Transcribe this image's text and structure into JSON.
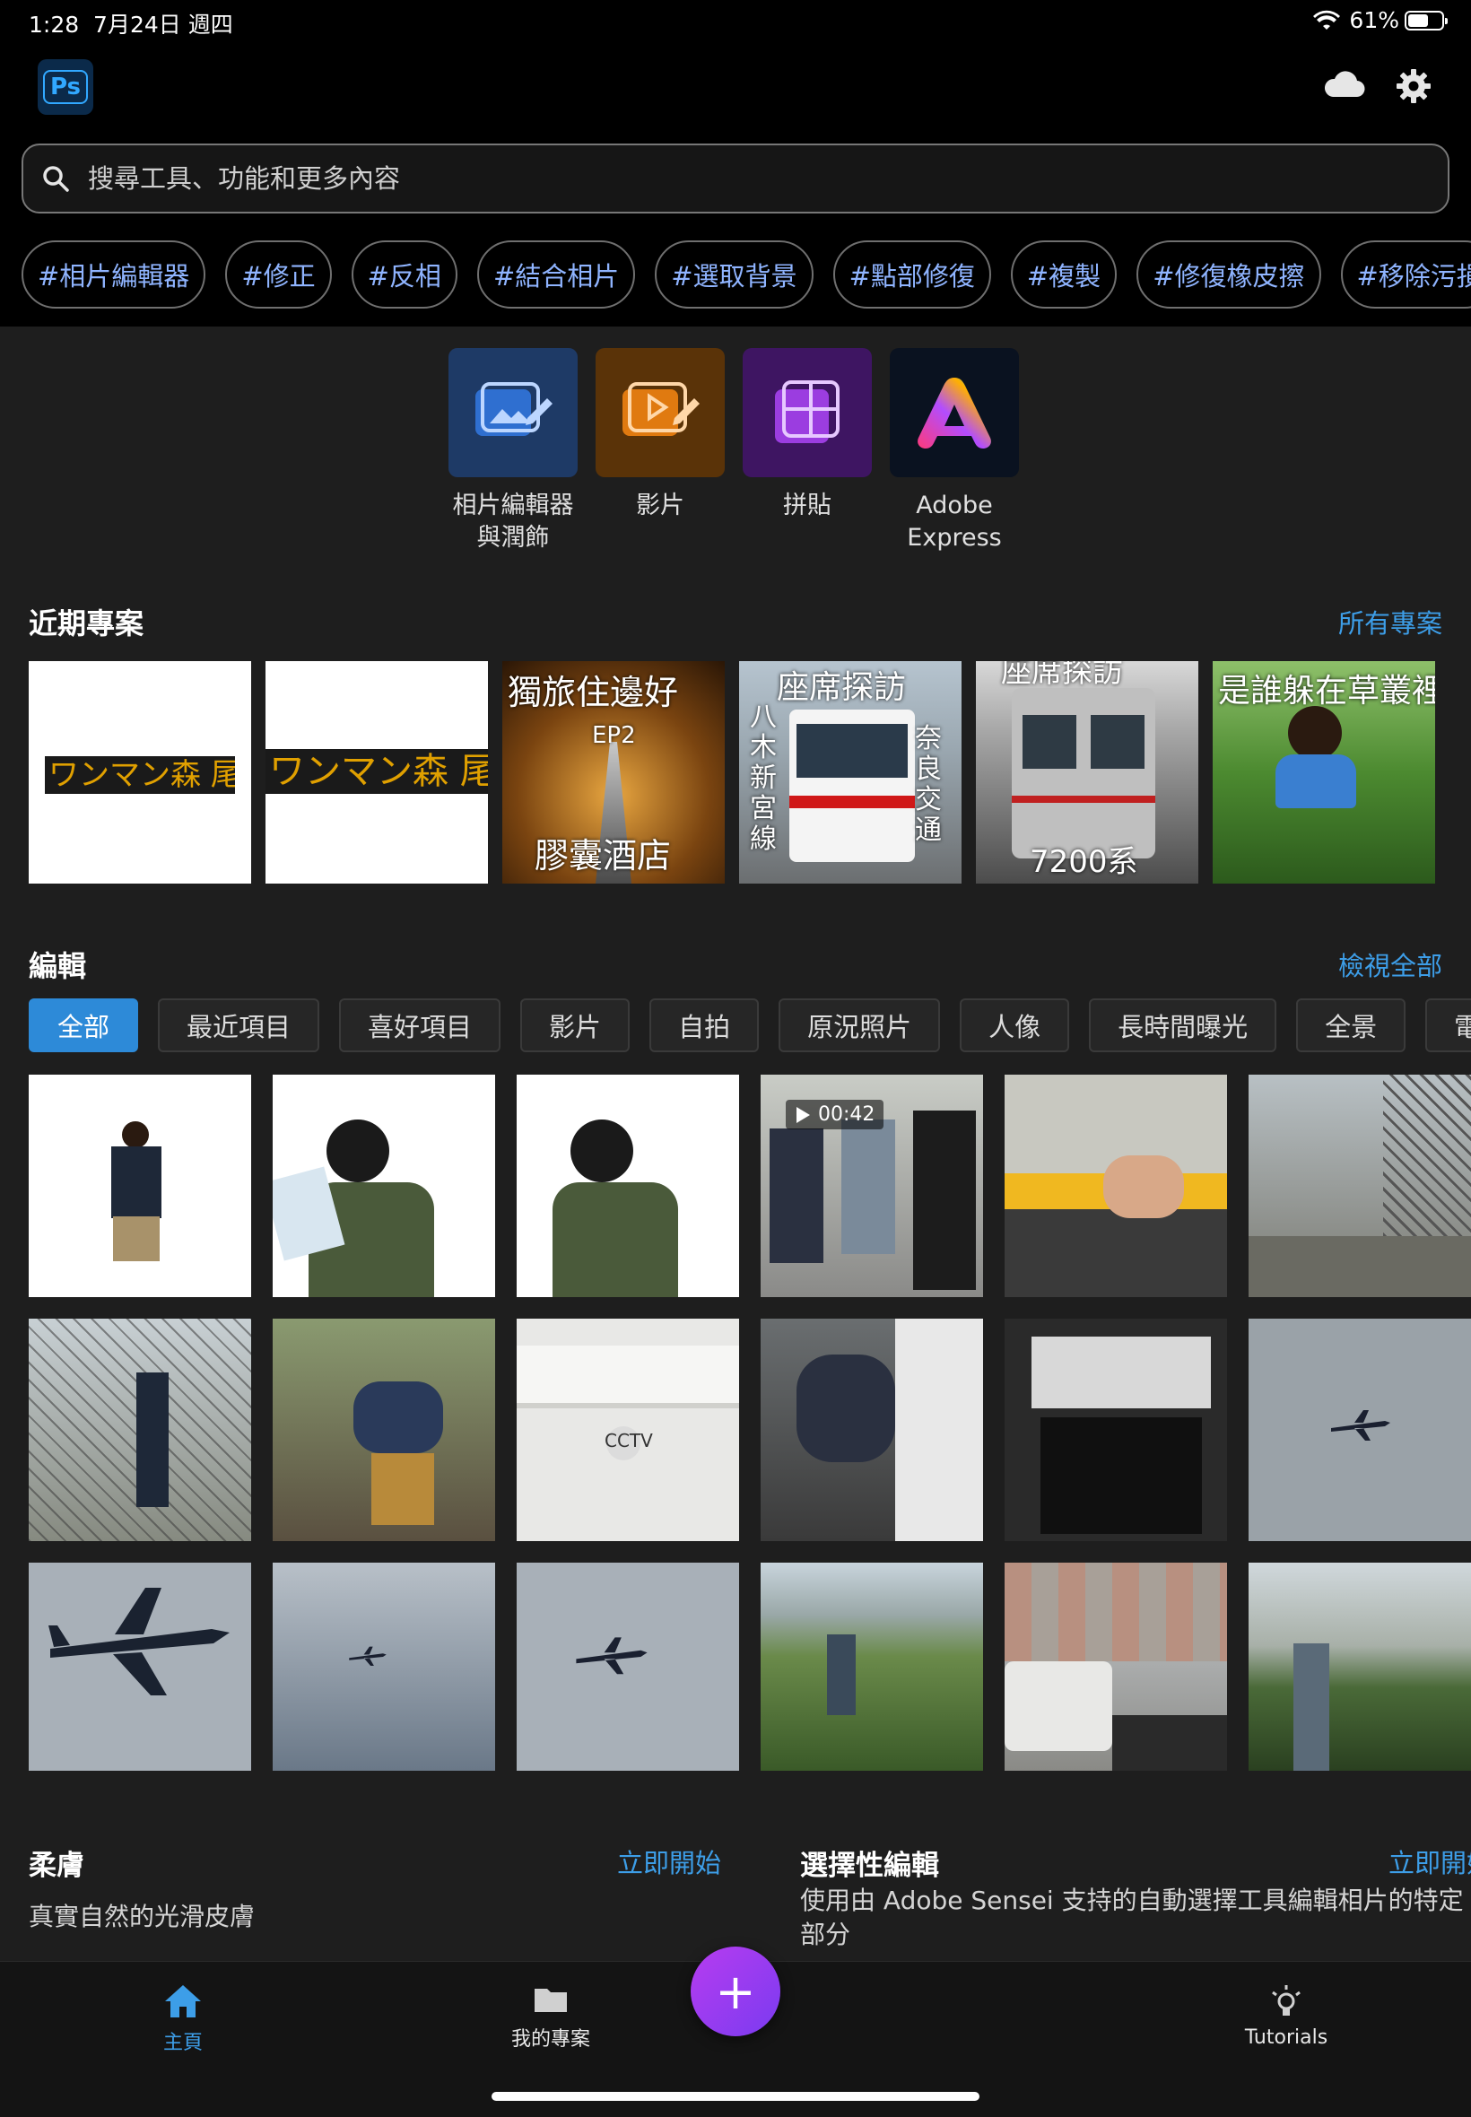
{
  "status": {
    "time": "1:28",
    "date": "7月24日 週四",
    "battery": "61%",
    "battery_level": 0.61
  },
  "app": {
    "logo_text": "Ps"
  },
  "search": {
    "placeholder": "搜尋工具、功能和更多內容"
  },
  "chips": [
    "#相片編輯器",
    "#修正",
    "#反相",
    "#結合相片",
    "#選取背景",
    "#點部修復",
    "#複製",
    "#修復橡皮擦",
    "#移除污損"
  ],
  "apps": [
    {
      "label": "相片編輯器\n與潤飾",
      "icon": "photo-edit-icon",
      "bg": "#1e3a66"
    },
    {
      "label": "影片",
      "icon": "video-edit-icon",
      "bg": "#5a3308"
    },
    {
      "label": "拼貼",
      "icon": "collage-icon",
      "bg": "#3e1562"
    },
    {
      "label": "Adobe\nExpress",
      "icon": "adobe-express-icon",
      "bg": "#0a1220"
    }
  ],
  "recent": {
    "title": "近期專案",
    "link": "所有專案",
    "projects": [
      {
        "sign": "ワンマン森 尾"
      },
      {
        "sign": "ワンマン森 尾"
      },
      {
        "title": "獨旅住邊好",
        "sub": "EP2",
        "bottom": "膠囊酒店"
      },
      {
        "title": "座席探訪",
        "left": "八木新宮線",
        "right": "奈良交通"
      },
      {
        "title": "座席探訪",
        "bottom": "7200系"
      },
      {
        "title": "是誰躲在草叢裡"
      }
    ]
  },
  "edits": {
    "title": "編輯",
    "link": "檢視全部",
    "filters": [
      "全部",
      "最近項目",
      "喜好項目",
      "影片",
      "自拍",
      "原況照片",
      "人像",
      "長時間曝光",
      "全景",
      "電影"
    ],
    "video_duration": "00:42",
    "cctv_label": "CCTV"
  },
  "cards": [
    {
      "title": "柔膚",
      "link": "立即開始",
      "desc": "真實自然的光滑皮膚"
    },
    {
      "title": "選擇性編輯",
      "link": "立即開始",
      "desc": "使用由 Adobe Sensei 支持的自動選擇工具編輯相片的特定部分"
    }
  ],
  "tabbar": {
    "home": "主頁",
    "projects": "我的專案",
    "tutorials": "Tutorials",
    "fab": "+"
  },
  "colors": {
    "accent": "#3d9ee8",
    "chip_text": "#8fb4ff",
    "fab": "#a33cf0"
  }
}
